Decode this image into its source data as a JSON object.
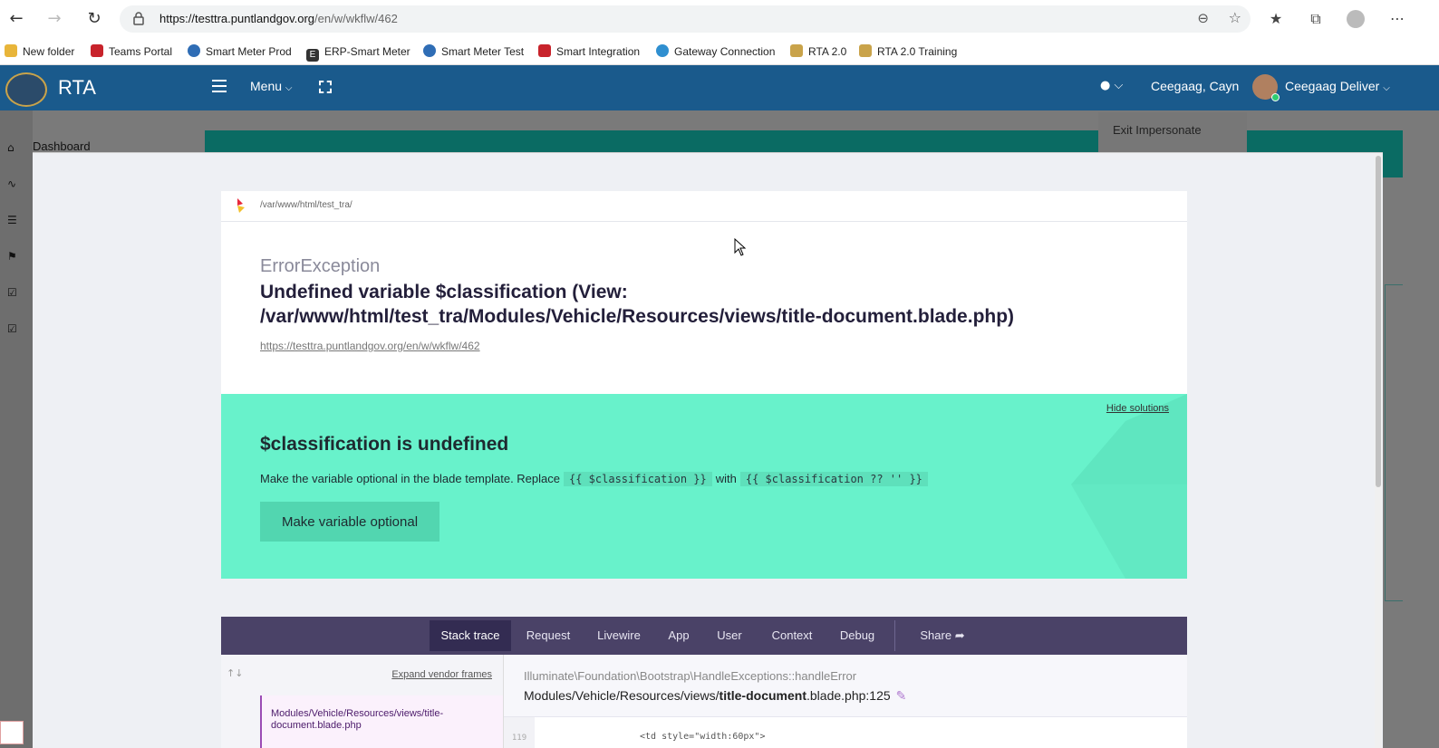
{
  "browser": {
    "url_host": "https://testtra.puntlandgov.org",
    "url_path": "/en/w/wkflw/462",
    "bookmarks": [
      {
        "label": "New folder",
        "color": "#e8b53a"
      },
      {
        "label": "Teams Portal",
        "color": "#c8232b"
      },
      {
        "label": "Smart Meter Prod",
        "color": "#2f6db5"
      },
      {
        "label": "ERP-Smart Meter",
        "color": "#333333"
      },
      {
        "label": "Smart Meter Test",
        "color": "#2f6db5"
      },
      {
        "label": "Smart Integration",
        "color": "#c8232b"
      },
      {
        "label": "Gateway Connection",
        "color": "#2f8fd0"
      },
      {
        "label": "RTA 2.0",
        "color": "#c9a34a"
      },
      {
        "label": "RTA 2.0 Training",
        "color": "#c9a34a"
      }
    ]
  },
  "header": {
    "app_name": "RTA",
    "menu_label": "Menu",
    "user_short": "Ceegaag, Cayn",
    "user_full": "Ceegaag Deliver",
    "brand_color": "#1a5a8c"
  },
  "page": {
    "sidebar_label": "Dashboard",
    "dropdown_item": "Exit Impersonate"
  },
  "error": {
    "path": "/var/www/html/test_tra/",
    "type": "ErrorException",
    "message": "Undefined variable $classification (View: /var/www/html/test_tra/Modules/Vehicle/Resources/views/title-document.blade.php)",
    "url": "https://testtra.puntlandgov.org/en/w/wkflw/462"
  },
  "solution": {
    "hide_label": "Hide solutions",
    "title": "$classification is undefined",
    "desc_before": "Make the variable optional in the blade template. Replace",
    "code_from": "{{ $classification }}",
    "desc_mid": "with",
    "code_to": "{{ $classification ?? '' }}",
    "button_label": "Make variable optional",
    "color": "#68f2cb"
  },
  "tabs": [
    "Stack trace",
    "Request",
    "Livewire",
    "App",
    "User",
    "Context",
    "Debug",
    "Share"
  ],
  "stack": {
    "expand_label": "Expand vendor frames",
    "frame_file": "Modules/Vehicle/Resources/views/title-document.blade.php",
    "class_method": "Illuminate\\Foundation\\Bootstrap\\HandleExceptions::handleError",
    "file_path": "Modules/Vehicle/Resources/views/",
    "file_name": "title-document",
    "file_ext_line": ".blade.php:125",
    "line_number": "119",
    "code_snippet": "<td style=\"width:60px\">"
  }
}
